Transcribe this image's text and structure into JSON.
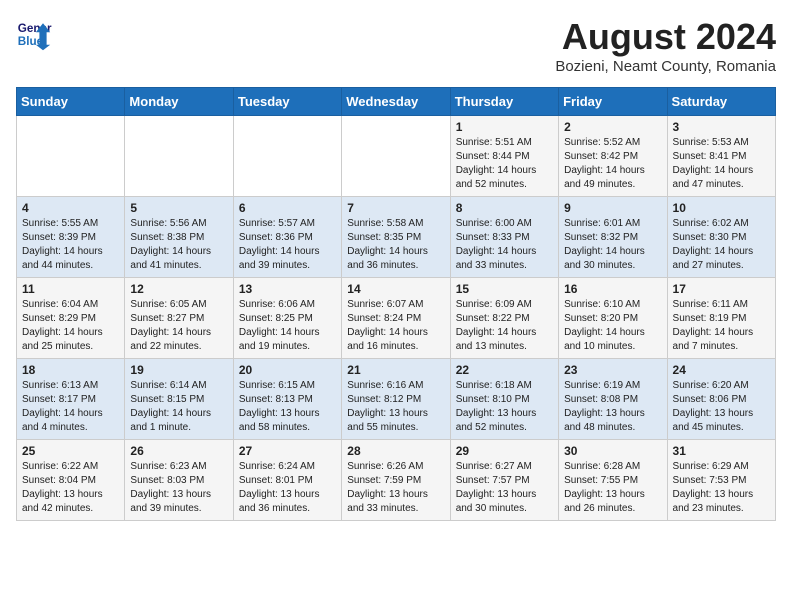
{
  "header": {
    "logo_line1": "General",
    "logo_line2": "Blue",
    "month_year": "August 2024",
    "location": "Bozieni, Neamt County, Romania"
  },
  "weekdays": [
    "Sunday",
    "Monday",
    "Tuesday",
    "Wednesday",
    "Thursday",
    "Friday",
    "Saturday"
  ],
  "weeks": [
    [
      {
        "day": "",
        "info": ""
      },
      {
        "day": "",
        "info": ""
      },
      {
        "day": "",
        "info": ""
      },
      {
        "day": "",
        "info": ""
      },
      {
        "day": "1",
        "info": "Sunrise: 5:51 AM\nSunset: 8:44 PM\nDaylight: 14 hours\nand 52 minutes."
      },
      {
        "day": "2",
        "info": "Sunrise: 5:52 AM\nSunset: 8:42 PM\nDaylight: 14 hours\nand 49 minutes."
      },
      {
        "day": "3",
        "info": "Sunrise: 5:53 AM\nSunset: 8:41 PM\nDaylight: 14 hours\nand 47 minutes."
      }
    ],
    [
      {
        "day": "4",
        "info": "Sunrise: 5:55 AM\nSunset: 8:39 PM\nDaylight: 14 hours\nand 44 minutes."
      },
      {
        "day": "5",
        "info": "Sunrise: 5:56 AM\nSunset: 8:38 PM\nDaylight: 14 hours\nand 41 minutes."
      },
      {
        "day": "6",
        "info": "Sunrise: 5:57 AM\nSunset: 8:36 PM\nDaylight: 14 hours\nand 39 minutes."
      },
      {
        "day": "7",
        "info": "Sunrise: 5:58 AM\nSunset: 8:35 PM\nDaylight: 14 hours\nand 36 minutes."
      },
      {
        "day": "8",
        "info": "Sunrise: 6:00 AM\nSunset: 8:33 PM\nDaylight: 14 hours\nand 33 minutes."
      },
      {
        "day": "9",
        "info": "Sunrise: 6:01 AM\nSunset: 8:32 PM\nDaylight: 14 hours\nand 30 minutes."
      },
      {
        "day": "10",
        "info": "Sunrise: 6:02 AM\nSunset: 8:30 PM\nDaylight: 14 hours\nand 27 minutes."
      }
    ],
    [
      {
        "day": "11",
        "info": "Sunrise: 6:04 AM\nSunset: 8:29 PM\nDaylight: 14 hours\nand 25 minutes."
      },
      {
        "day": "12",
        "info": "Sunrise: 6:05 AM\nSunset: 8:27 PM\nDaylight: 14 hours\nand 22 minutes."
      },
      {
        "day": "13",
        "info": "Sunrise: 6:06 AM\nSunset: 8:25 PM\nDaylight: 14 hours\nand 19 minutes."
      },
      {
        "day": "14",
        "info": "Sunrise: 6:07 AM\nSunset: 8:24 PM\nDaylight: 14 hours\nand 16 minutes."
      },
      {
        "day": "15",
        "info": "Sunrise: 6:09 AM\nSunset: 8:22 PM\nDaylight: 14 hours\nand 13 minutes."
      },
      {
        "day": "16",
        "info": "Sunrise: 6:10 AM\nSunset: 8:20 PM\nDaylight: 14 hours\nand 10 minutes."
      },
      {
        "day": "17",
        "info": "Sunrise: 6:11 AM\nSunset: 8:19 PM\nDaylight: 14 hours\nand 7 minutes."
      }
    ],
    [
      {
        "day": "18",
        "info": "Sunrise: 6:13 AM\nSunset: 8:17 PM\nDaylight: 14 hours\nand 4 minutes."
      },
      {
        "day": "19",
        "info": "Sunrise: 6:14 AM\nSunset: 8:15 PM\nDaylight: 14 hours\nand 1 minute."
      },
      {
        "day": "20",
        "info": "Sunrise: 6:15 AM\nSunset: 8:13 PM\nDaylight: 13 hours\nand 58 minutes."
      },
      {
        "day": "21",
        "info": "Sunrise: 6:16 AM\nSunset: 8:12 PM\nDaylight: 13 hours\nand 55 minutes."
      },
      {
        "day": "22",
        "info": "Sunrise: 6:18 AM\nSunset: 8:10 PM\nDaylight: 13 hours\nand 52 minutes."
      },
      {
        "day": "23",
        "info": "Sunrise: 6:19 AM\nSunset: 8:08 PM\nDaylight: 13 hours\nand 48 minutes."
      },
      {
        "day": "24",
        "info": "Sunrise: 6:20 AM\nSunset: 8:06 PM\nDaylight: 13 hours\nand 45 minutes."
      }
    ],
    [
      {
        "day": "25",
        "info": "Sunrise: 6:22 AM\nSunset: 8:04 PM\nDaylight: 13 hours\nand 42 minutes."
      },
      {
        "day": "26",
        "info": "Sunrise: 6:23 AM\nSunset: 8:03 PM\nDaylight: 13 hours\nand 39 minutes."
      },
      {
        "day": "27",
        "info": "Sunrise: 6:24 AM\nSunset: 8:01 PM\nDaylight: 13 hours\nand 36 minutes."
      },
      {
        "day": "28",
        "info": "Sunrise: 6:26 AM\nSunset: 7:59 PM\nDaylight: 13 hours\nand 33 minutes."
      },
      {
        "day": "29",
        "info": "Sunrise: 6:27 AM\nSunset: 7:57 PM\nDaylight: 13 hours\nand 30 minutes."
      },
      {
        "day": "30",
        "info": "Sunrise: 6:28 AM\nSunset: 7:55 PM\nDaylight: 13 hours\nand 26 minutes."
      },
      {
        "day": "31",
        "info": "Sunrise: 6:29 AM\nSunset: 7:53 PM\nDaylight: 13 hours\nand 23 minutes."
      }
    ]
  ]
}
